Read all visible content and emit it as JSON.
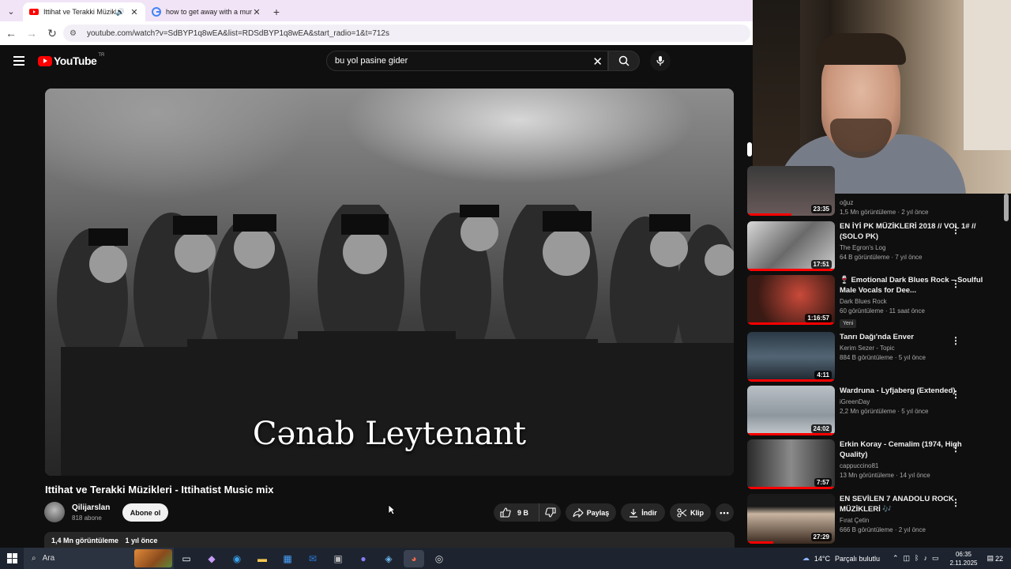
{
  "browser": {
    "tabs": [
      {
        "title": "Ittihat ve Terakki Müzikleri",
        "active": true
      },
      {
        "title": "how to get away with a murder",
        "active": false
      }
    ],
    "url": "youtube.com/watch?v=SdBYP1q8wEA&list=RDSdBYP1q8wEA&start_radio=1&t=712s"
  },
  "youtube": {
    "logo_text": "YouTube",
    "country_code": "TR",
    "search_value": "bu yol pasine gider"
  },
  "video": {
    "caption": "Cənab Leytenant",
    "title": "Ittihat ve Terakki Müzikleri - Ittihatist Music mix",
    "channel": "Qilijarslan",
    "subscribers": "818 abone",
    "subscribe_label": "Abone ol",
    "likes": "9 B",
    "share_label": "Paylaş",
    "download_label": "İndir",
    "clip_label": "Klip",
    "views": "1,4 Mn görüntüleme",
    "age": "1 yıl önce"
  },
  "sidebar": {
    "items": [
      {
        "title": "",
        "channel": "oğuz",
        "meta": "1,5 Mn görüntüleme · 2 yıl önce",
        "duration": "23:35",
        "progress": 0.5,
        "badge": ""
      },
      {
        "title": "EN İYİ PK MÜZİKLERİ 2018 // VOL 1# // (SOLO PK)",
        "channel": "The Egron's Log",
        "meta": "64 B görüntüleme · 7 yıl önce",
        "duration": "17:51",
        "progress": 1,
        "badge": ""
      },
      {
        "title": "🍷 Emotional Dark Blues Rock – Soulful Male Vocals for Dee...",
        "channel": "Dark Blues Rock",
        "meta": "60 görüntüleme · 11 saat önce",
        "duration": "1:16:57",
        "progress": 1,
        "badge": "Yeni"
      },
      {
        "title": "Tanrı Dağı'nda Enver",
        "channel": "Kerim Sezer - Topic",
        "meta": "884 B görüntüleme · 5 yıl önce",
        "duration": "4:11",
        "progress": 1,
        "badge": ""
      },
      {
        "title": "Wardruna - Lyfjaberg (Extended)",
        "channel": "iGreenDay",
        "meta": "2,2 Mn görüntüleme · 5 yıl önce",
        "duration": "24:02",
        "progress": 1,
        "badge": ""
      },
      {
        "title": "Erkin Koray - Cemalim (1974, High Quality)",
        "channel": "cappuccino81",
        "meta": "13 Mn görüntüleme · 14 yıl önce",
        "duration": "7:57",
        "progress": 1,
        "badge": ""
      },
      {
        "title": "EN SEVİLEN 7 ANADOLU ROCK MÜZİKLERİ 🎶",
        "channel": "Fırat Çetin",
        "meta": "666 B görüntüleme · 2 yıl önce",
        "duration": "27:29",
        "progress": 0.3,
        "badge": ""
      }
    ]
  },
  "taskbar": {
    "search_label": "Ara",
    "weather": "14°C",
    "weather_text": "Parçalı bulutlu",
    "time": "06:35",
    "date": "2.11.2025",
    "notifications": "22"
  },
  "colors": {
    "accent": "#ff0000",
    "background": "#0f0f0f",
    "tabstrip": "#f2e4f7"
  }
}
